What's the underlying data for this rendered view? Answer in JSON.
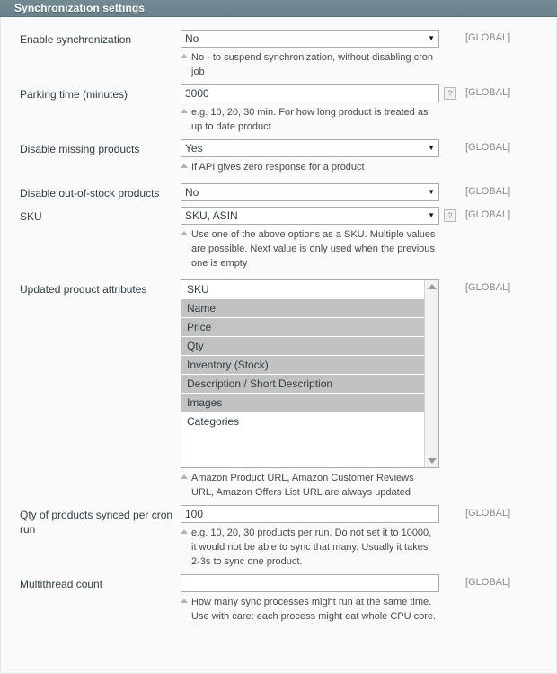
{
  "panel": {
    "title": "Synchronization settings",
    "scope_label": "[GLOBAL]",
    "help_glyph": "?",
    "dropdown_glyph": "▼"
  },
  "fields": [
    {
      "label": "Enable synchronization",
      "type": "select",
      "value": "No",
      "has_help": false,
      "scope": "[GLOBAL]",
      "note": "No - to suspend synchronization, without disabling cron job"
    },
    {
      "label": "Parking time (minutes)",
      "type": "input",
      "value": "3000",
      "has_help": true,
      "scope": "[GLOBAL]",
      "note": "e.g. 10, 20, 30 min. For how long product is treated as up to date product"
    },
    {
      "label": "Disable missing products",
      "type": "select",
      "value": "Yes",
      "has_help": false,
      "scope": "[GLOBAL]",
      "note": "If API gives zero response for a product"
    },
    {
      "label": "Disable out-of-stock products",
      "type": "select",
      "value": "No",
      "has_help": false,
      "scope": "[GLOBAL]",
      "note": ""
    },
    {
      "label": "SKU",
      "type": "select",
      "value": "SKU, ASIN",
      "has_help": true,
      "scope": "[GLOBAL]",
      "note": "Use one of the above options as a SKU. Multiple values are possible. Next value is only used when the previous one is empty"
    },
    {
      "label": "Updated product attributes",
      "type": "multiselect",
      "scope": "[GLOBAL]",
      "options": [
        {
          "label": "SKU",
          "selected": false
        },
        {
          "label": "Name",
          "selected": true
        },
        {
          "label": "Price",
          "selected": true
        },
        {
          "label": "Qty",
          "selected": true
        },
        {
          "label": "Inventory (Stock)",
          "selected": true
        },
        {
          "label": "Description / Short Description",
          "selected": true
        },
        {
          "label": "Images",
          "selected": true
        },
        {
          "label": "Categories",
          "selected": false
        }
      ],
      "note": "Amazon Product URL, Amazon Customer Reviews URL, Amazon Offers List URL are always updated"
    },
    {
      "label": "Qty of products synced per cron run",
      "type": "input",
      "value": "100",
      "has_help": false,
      "scope": "[GLOBAL]",
      "note": "e.g. 10, 20, 30 products per run. Do not set it to 10000, it would not be able to sync that many. Usually it takes 2-3s to sync one product."
    },
    {
      "label": "Multithread count",
      "type": "input",
      "value": "",
      "has_help": false,
      "scope": "[GLOBAL]",
      "note": "How many sync processes might run at the same time. Use with care: each process might eat whole CPU core."
    }
  ]
}
